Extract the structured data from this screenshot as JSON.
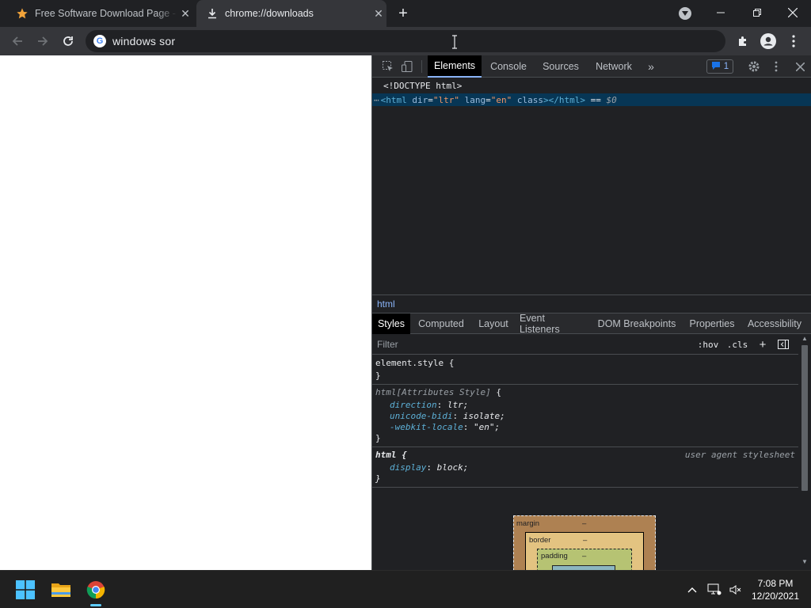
{
  "tabs": [
    {
      "title": "Free Software Download Page - S",
      "icon": "star-icon",
      "active": false
    },
    {
      "title": "chrome://downloads",
      "icon": "download-icon",
      "active": true
    }
  ],
  "omnibox": {
    "text": "windows  sor"
  },
  "devtools": {
    "main_tabs": [
      "Elements",
      "Console",
      "Sources",
      "Network"
    ],
    "issues_count": "1",
    "tree": {
      "doctype": "<!DOCTYPE html>",
      "html_open": "<html",
      "attr1_name": "dir",
      "attr1_value": "\"ltr\"",
      "attr2_name": "lang",
      "attr2_value": "\"en\"",
      "attr3_name": "class",
      "html_close": "></html>",
      "eq": "==",
      "dollar": "$0"
    },
    "breadcrumb": "html",
    "sub_tabs": [
      "Styles",
      "Computed",
      "Layout",
      "Event Listeners",
      "DOM Breakpoints",
      "Properties",
      "Accessibility"
    ],
    "filter_placeholder": "Filter",
    "hov": ":hov",
    "cls": ".cls",
    "rules": {
      "element_style": {
        "selector": "element.style {",
        "close": "}"
      },
      "attributes": {
        "selector": "html[Attributes Style]",
        "brace": "{",
        "decls": [
          {
            "prop": "direction",
            "val": "ltr;"
          },
          {
            "prop": "unicode-bidi",
            "val": "isolate;"
          },
          {
            "prop": "-webkit-locale",
            "val": "\"en\";"
          }
        ],
        "close": "}"
      },
      "ua": {
        "selector": "html {",
        "origin": "user agent stylesheet",
        "decls": [
          {
            "prop": "display",
            "val": "block;"
          }
        ],
        "close": "}"
      }
    },
    "box_model": {
      "margin": "margin",
      "border": "border",
      "padding": "padding",
      "dash": "–"
    }
  },
  "taskbar": {
    "time": "7:08 PM",
    "date": "12/20/2021"
  },
  "colors": {
    "accent": "#8ab4f8",
    "selection": "#073655",
    "star": "#f2a33a"
  }
}
